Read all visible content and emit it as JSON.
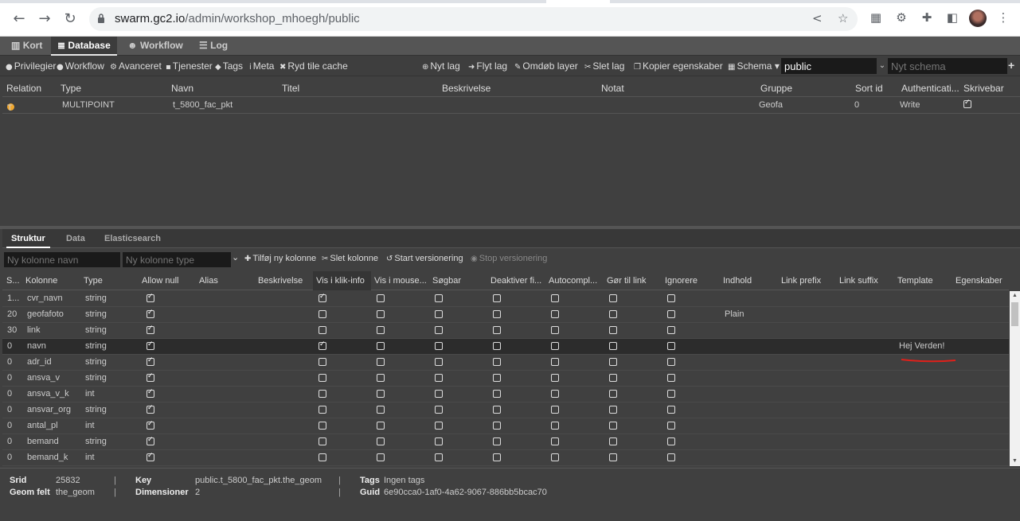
{
  "browser": {
    "url_host": "swarm.gc2.io",
    "url_path": "/admin/workshop_mhoegh/public"
  },
  "app_tabs": [
    {
      "label": "Kort",
      "icon": "map-icon"
    },
    {
      "label": "Database",
      "icon": "database-icon"
    },
    {
      "label": "Workflow",
      "icon": "users-icon"
    },
    {
      "label": "Log",
      "icon": "list-icon"
    }
  ],
  "toolbar": {
    "privileges": "Privilegier",
    "workflow": "Workflow",
    "advanced": "Avanceret",
    "services": "Tjenester",
    "tags": "Tags",
    "meta": "Meta",
    "clear_cache": "Ryd tile cache",
    "new_layer": "Nyt lag",
    "move_layer": "Flyt lag",
    "rename_layer": "Omdøb layer",
    "delete_layer": "Slet lag",
    "copy_props": "Kopier egenskaber",
    "schema": "Schema",
    "schema_value": "public",
    "new_schema_placeholder": "Nyt schema"
  },
  "layer_grid": {
    "headers": [
      "Relation",
      "Type",
      "Navn",
      "Titel",
      "Beskrivelse",
      "Notat",
      "Gruppe",
      "Sort id",
      "Authenticati...",
      "Skrivebar"
    ],
    "rows": [
      {
        "relation": "T",
        "type": "MULTIPOINT",
        "navn": "t_5800_fac_pkt",
        "titel": "",
        "beskrivelse": "",
        "notat": "",
        "gruppe": "Geofa",
        "sort_id": "0",
        "auth": "Write",
        "skrivebar": true
      }
    ]
  },
  "sub_tabs": [
    "Struktur",
    "Data",
    "Elasticsearch"
  ],
  "column_tools": {
    "new_name_placeholder": "Ny kolonne navn",
    "new_type_placeholder": "Ny kolonne type",
    "add": "Tilføj ny kolonne",
    "delete": "Slet kolonne",
    "start_versioning": "Start versionering",
    "stop_versioning": "Stop versionering"
  },
  "structure": {
    "headers": [
      "S...",
      "Kolonne",
      "Type",
      "Allow null",
      "Alias",
      "Beskrivelse",
      "Vis i klik-info",
      "Vis i mouse...",
      "Søgbar",
      "Deaktiver fi...",
      "Autocompl...",
      "Gør til link",
      "Ignorere",
      "Indhold",
      "Link prefix",
      "Link suffix",
      "Template",
      "Egenskaber"
    ],
    "rows": [
      {
        "s": "1...",
        "col": "cvr_navn",
        "type": "string",
        "null": true,
        "klik": true,
        "mouse": false,
        "sog": false,
        "deakt": false,
        "auto": false,
        "link": false,
        "ign": false,
        "indhold": "",
        "template": ""
      },
      {
        "s": "20",
        "col": "geofafoto",
        "type": "string",
        "null": true,
        "klik": false,
        "mouse": false,
        "sog": false,
        "deakt": false,
        "auto": false,
        "link": false,
        "ign": false,
        "indhold": "Plain",
        "template": ""
      },
      {
        "s": "30",
        "col": "link",
        "type": "string",
        "null": true,
        "klik": false,
        "mouse": false,
        "sog": false,
        "deakt": false,
        "auto": false,
        "link": false,
        "ign": false,
        "indhold": "",
        "template": ""
      },
      {
        "s": "0",
        "col": "navn",
        "type": "string",
        "null": true,
        "klik": true,
        "mouse": false,
        "sog": false,
        "deakt": false,
        "auto": false,
        "link": false,
        "ign": false,
        "indhold": "",
        "template": "Hej Verden!",
        "selected": true
      },
      {
        "s": "0",
        "col": "adr_id",
        "type": "string",
        "null": true,
        "klik": false,
        "mouse": false,
        "sog": false,
        "deakt": false,
        "auto": false,
        "link": false,
        "ign": false,
        "indhold": "",
        "template": ""
      },
      {
        "s": "0",
        "col": "ansva_v",
        "type": "string",
        "null": true,
        "klik": false,
        "mouse": false,
        "sog": false,
        "deakt": false,
        "auto": false,
        "link": false,
        "ign": false,
        "indhold": "",
        "template": ""
      },
      {
        "s": "0",
        "col": "ansva_v_k",
        "type": "int",
        "null": true,
        "klik": false,
        "mouse": false,
        "sog": false,
        "deakt": false,
        "auto": false,
        "link": false,
        "ign": false,
        "indhold": "",
        "template": ""
      },
      {
        "s": "0",
        "col": "ansvar_org",
        "type": "string",
        "null": true,
        "klik": false,
        "mouse": false,
        "sog": false,
        "deakt": false,
        "auto": false,
        "link": false,
        "ign": false,
        "indhold": "",
        "template": ""
      },
      {
        "s": "0",
        "col": "antal_pl",
        "type": "int",
        "null": true,
        "klik": false,
        "mouse": false,
        "sog": false,
        "deakt": false,
        "auto": false,
        "link": false,
        "ign": false,
        "indhold": "",
        "template": ""
      },
      {
        "s": "0",
        "col": "bemand",
        "type": "string",
        "null": true,
        "klik": false,
        "mouse": false,
        "sog": false,
        "deakt": false,
        "auto": false,
        "link": false,
        "ign": false,
        "indhold": "",
        "template": ""
      },
      {
        "s": "0",
        "col": "bemand_k",
        "type": "int",
        "null": true,
        "klik": false,
        "mouse": false,
        "sog": false,
        "deakt": false,
        "auto": false,
        "link": false,
        "ign": false,
        "indhold": "",
        "template": ""
      }
    ]
  },
  "info": {
    "srid_label": "Srid",
    "srid": "25832",
    "geom_label": "Geom felt",
    "geom": "the_geom",
    "key_label": "Key",
    "key": "public.t_5800_fac_pkt.the_geom",
    "dim_label": "Dimensioner",
    "dim": "2",
    "tags_label": "Tags",
    "tags": "Ingen tags",
    "guid_label": "Guid",
    "guid": "6e90cca0-1af0-4a62-9067-886bb5bcac70"
  }
}
